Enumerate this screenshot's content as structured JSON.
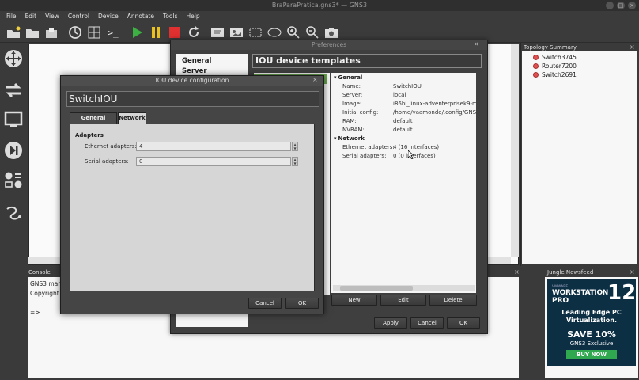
{
  "window": {
    "title": "BraParaPratica.gns3* — GNS3"
  },
  "menu": [
    "File",
    "Edit",
    "View",
    "Control",
    "Device",
    "Annotate",
    "Tools",
    "Help"
  ],
  "toolbar": {
    "icons": [
      "new-project-icon",
      "open-project-icon",
      "save-project-icon",
      "snapshot-clock-icon",
      "screenshot-grid-icon",
      "console-icon",
      "start-icon",
      "pause-icon",
      "stop-icon",
      "reload-icon",
      "add-note-icon",
      "insert-image-icon",
      "draw-rectangle-icon",
      "draw-ellipse-icon",
      "zoom-in-icon",
      "zoom-out-icon",
      "camera-icon"
    ]
  },
  "topology": {
    "title": "Topology Summary",
    "items": [
      "Switch3745",
      "Router7200",
      "Switch2691"
    ],
    "status_color": "#e05050"
  },
  "console": {
    "title": "Console",
    "lines": [
      "GNS3 mana",
      "Copyright (c",
      "",
      "=>"
    ]
  },
  "newsfeed": {
    "title": "Jungle Newsfeed",
    "ad": {
      "vendor": "VMWARE",
      "product": "WORKSTATION",
      "edition": "PRO",
      "version": "12",
      "headline": "Leading Edge PC Virtualization.",
      "offer": "SAVE 10%",
      "subtitle": "GNS3 Exclusive",
      "cta": "BUY NOW"
    }
  },
  "preferences": {
    "title": "Preferences",
    "nav": [
      "General",
      "Server"
    ],
    "heading": "IOU device templates",
    "sections": [
      {
        "name": "General",
        "rows": [
          {
            "key": "Name:",
            "value": "SwitchIOU"
          },
          {
            "key": "Server:",
            "value": "local"
          },
          {
            "key": "Image:",
            "value": "i86bi_linux-adventerprisek9-m-15"
          },
          {
            "key": "Initial config:",
            "value": "/home/vaamonde/.config/GNS3/"
          },
          {
            "key": "RAM:",
            "value": "default"
          },
          {
            "key": "NVRAM:",
            "value": "default"
          }
        ]
      },
      {
        "name": "Network",
        "rows": [
          {
            "key": "Ethernet adapters:",
            "value": "4 (16 interfaces)"
          },
          {
            "key": "Serial adapters:",
            "value": "0 (0 interfaces)"
          }
        ]
      }
    ],
    "buttons": {
      "new": "New",
      "edit": "Edit",
      "delete": "Delete",
      "apply": "Apply",
      "cancel": "Cancel",
      "ok": "OK"
    }
  },
  "iou_dialog": {
    "title": "IOU device configuration",
    "heading": "SwitchIOU",
    "tabs": [
      "General settings",
      "Network"
    ],
    "active_tab": "Network",
    "group": "Adapters",
    "fields": [
      {
        "label": "Ethernet adapters:",
        "value": "4"
      },
      {
        "label": "Serial adapters:",
        "value": "0"
      }
    ],
    "buttons": {
      "cancel": "Cancel",
      "ok": "OK"
    }
  }
}
